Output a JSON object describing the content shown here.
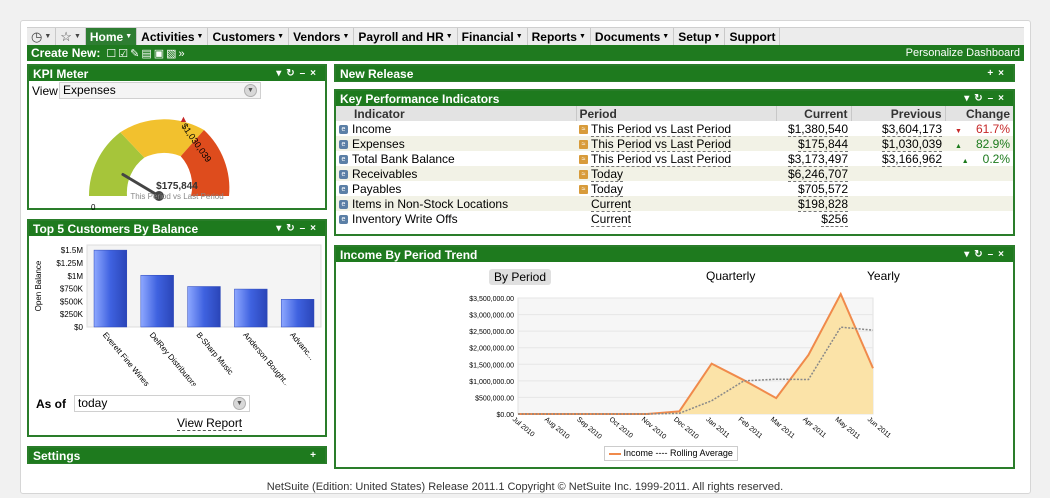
{
  "nav": {
    "items": [
      {
        "label": "Home"
      },
      {
        "label": "Activities"
      },
      {
        "label": "Customers"
      },
      {
        "label": "Vendors"
      },
      {
        "label": "Payroll and HR"
      },
      {
        "label": "Financial"
      },
      {
        "label": "Reports"
      },
      {
        "label": "Documents"
      },
      {
        "label": "Setup"
      },
      {
        "label": "Support"
      }
    ],
    "create_new": "Create New:",
    "personalize": "Personalize Dashboard"
  },
  "kpi_meter": {
    "title": "KPI Meter",
    "view_label": "View",
    "view_value": "Expenses",
    "gauge_min": "0",
    "gauge_max": "$1,030,039",
    "value": "$175,844",
    "subtitle": "This Period vs Last Period",
    "level": 0.171
  },
  "top5": {
    "title": "Top 5 Customers By Balance",
    "as_of_label": "As of",
    "as_of_value": "today",
    "view_report": "View Report"
  },
  "settings": {
    "title": "Settings"
  },
  "new_release": {
    "title": "New Release"
  },
  "kpi": {
    "title": "Key Performance Indicators",
    "headers": [
      "Indicator",
      "Period",
      "Current",
      "Previous",
      "Change"
    ],
    "rows": [
      {
        "indicator": "Income",
        "period": "This Period vs Last Period",
        "current": "$1,380,540",
        "previous": "$3,604,173",
        "change": "61.7%",
        "dir": "down"
      },
      {
        "indicator": "Expenses",
        "period": "This Period vs Last Period",
        "current": "$175,844",
        "previous": "$1,030,039",
        "change": "82.9%",
        "dir": "up"
      },
      {
        "indicator": "Total Bank Balance",
        "period": "This Period vs Last Period",
        "current": "$3,173,497",
        "previous": "$3,166,962",
        "change": "0.2%",
        "dir": "up"
      },
      {
        "indicator": "Receivables",
        "period": "Today",
        "current": "$6,246,707",
        "previous": "",
        "change": "",
        "dir": ""
      },
      {
        "indicator": "Payables",
        "period": "Today",
        "current": "$705,572",
        "previous": "",
        "change": "",
        "dir": ""
      },
      {
        "indicator": "Items in Non-Stock Locations",
        "period": "Current",
        "current": "$198,828",
        "previous": "",
        "change": "",
        "dir": ""
      },
      {
        "indicator": "Inventory Write Offs",
        "period": "Current",
        "current": "$256",
        "previous": "",
        "change": "",
        "dir": ""
      }
    ]
  },
  "trend": {
    "title": "Income By Period Trend",
    "tabs": [
      "By Period",
      "Quarterly",
      "Yearly"
    ],
    "legend": "Income ---- Rolling Average"
  },
  "footer": "NetSuite (Edition: United States) Release 2011.1 Copyright © NetSuite Inc. 1999-2011. All rights reserved.",
  "chart_data": [
    {
      "type": "bar",
      "ylabel": "Open Balance",
      "categories": [
        "Everett Fine Wines",
        "DelRey Distributors",
        "B-Sharp Music",
        "Anderson Bought...",
        "Advanc..."
      ],
      "values": [
        1500000,
        1010000,
        790000,
        740000,
        540000
      ],
      "yticks": [
        "$0",
        "$250K",
        "$500K",
        "$750K",
        "$1M",
        "$1.25M",
        "$1.5M"
      ],
      "ylim": [
        0,
        1600000
      ],
      "grid": false,
      "color": "#3f62e0"
    },
    {
      "type": "area",
      "categories": [
        "Jul 2010",
        "Aug 2010",
        "Sep 2010",
        "Oct 2010",
        "Nov 2010",
        "Dec 2010",
        "Jan 2011",
        "Feb 2011",
        "Mar 2011",
        "Apr 2011",
        "May 2011",
        "Jun 2011"
      ],
      "series": [
        {
          "name": "Income",
          "values": [
            0,
            0,
            0,
            0,
            0,
            80000,
            1520000,
            1020000,
            480000,
            1780000,
            3620000,
            1380000
          ]
        },
        {
          "name": "Rolling Average",
          "values": [
            0,
            0,
            0,
            0,
            0,
            20000,
            400000,
            1000000,
            1050000,
            1040000,
            2620000,
            2530000
          ]
        }
      ],
      "yticks": [
        "$0.00",
        "$500,000.00",
        "$1,000,000.00",
        "$1,500,000.00",
        "$2,000,000.00",
        "$2,500,000.00",
        "$3,000,000.00",
        "$3,500,000.00"
      ],
      "ylim": [
        0,
        3500000
      ],
      "colors": {
        "fill": "#fbe3a8",
        "line": "#f08a4b",
        "avg": "#888888"
      }
    }
  ]
}
